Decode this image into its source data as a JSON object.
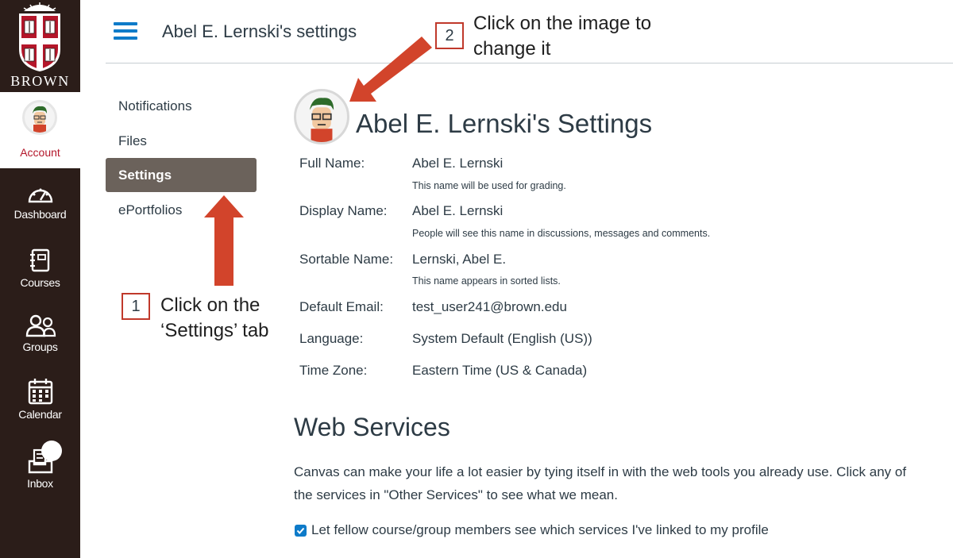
{
  "global_nav": {
    "logo_text": "BROWN",
    "account_label": "Account",
    "items": [
      {
        "label": "Dashboard",
        "icon": "dashboard-icon"
      },
      {
        "label": "Courses",
        "icon": "courses-icon"
      },
      {
        "label": "Groups",
        "icon": "groups-icon"
      },
      {
        "label": "Calendar",
        "icon": "calendar-icon"
      },
      {
        "label": "Inbox",
        "icon": "inbox-icon"
      }
    ]
  },
  "header": {
    "title": "Abel E. Lernski's settings"
  },
  "subnav": {
    "items": [
      "Notifications",
      "Files",
      "Settings",
      "ePortfolios"
    ],
    "active": "Settings"
  },
  "annotations": {
    "step1_number": "1",
    "step1_line1": "Click on the",
    "step1_line2": "‘Settings’ tab",
    "step2_number": "2",
    "step2_line1": "Click on the image to",
    "step2_line2": "change it",
    "arrow_color": "#d2442b"
  },
  "settings": {
    "title": "Abel E. Lernski's Settings",
    "full_name_label": "Full Name:",
    "full_name": "Abel E. Lernski",
    "full_name_hint": "This name will be used for grading.",
    "display_name_label": "Display Name:",
    "display_name": "Abel E. Lernski",
    "display_name_hint": "People will see this name in discussions, messages and comments.",
    "sortable_name_label": "Sortable Name:",
    "sortable_name": "Lernski, Abel E.",
    "sortable_name_hint": "This name appears in sorted lists.",
    "email_label": "Default Email:",
    "email": "test_user241@brown.edu",
    "language_label": "Language:",
    "language": "System Default (English (US))",
    "timezone_label": "Time Zone:",
    "timezone": "Eastern Time (US & Canada)"
  },
  "web_services": {
    "title": "Web Services",
    "description": "Canvas can make your life a lot easier by tying itself in with the web tools you already use. Click any of the services in \"Other Services\" to see what we mean.",
    "checkbox_label": "Let fellow course/group members see which services I've linked to my profile",
    "checkbox_checked": true
  },
  "colors": {
    "nav_bg": "#2b1d19",
    "account_red": "#b4162a",
    "link_blue": "#0e7bc9",
    "active_tab": "#6b625b"
  }
}
